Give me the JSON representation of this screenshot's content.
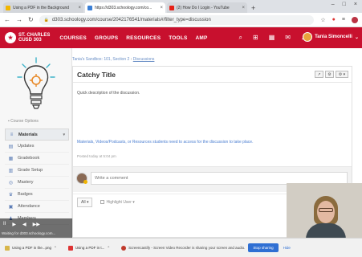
{
  "browser": {
    "tabs": [
      {
        "title": "Using a PDF in the Background",
        "favicon_color": "#f2b600"
      },
      {
        "title": "https://d303.schoology.com/co...",
        "favicon_color": "#3a7fd6"
      },
      {
        "title": "(2) How Do I Login - YouTube",
        "favicon_color": "#e62117"
      }
    ],
    "tab_close": "×",
    "new_tab": "+",
    "window_controls": [
      "–",
      "□",
      "×"
    ],
    "nav_back": "←",
    "nav_forward": "→",
    "nav_reload": "↻",
    "url": "d303.schoology.com/course/2042176541/materials#/filter_type=discussion",
    "lock_icon": "🔒"
  },
  "header": {
    "logo_line1": "ST. CHARLES",
    "logo_line2": "CUSD 303",
    "menu": [
      "COURSES",
      "GROUPS",
      "RESOURCES",
      "TOOLS",
      "AMP"
    ],
    "user_name": "Tania Simoncelli",
    "brand_color": "#c8102e"
  },
  "sidebar": {
    "course_options": "▪ Course Options",
    "items": [
      {
        "label": "Materials",
        "icon": "≡"
      },
      {
        "label": "Updates",
        "icon": "▤"
      },
      {
        "label": "Gradebook",
        "icon": "▦"
      },
      {
        "label": "Grade Setup",
        "icon": "▥"
      },
      {
        "label": "Mastery",
        "icon": "◎"
      },
      {
        "label": "Badges",
        "icon": "♛"
      },
      {
        "label": "Attendance",
        "icon": "▣"
      },
      {
        "label": "Members",
        "icon": "♟"
      }
    ],
    "chevron": "▾"
  },
  "content": {
    "breadcrumb": [
      "Tania's Sandbox: 101, Section 2",
      "Discussions"
    ],
    "breadcrumb_sep": "›",
    "title": "Catchy Title",
    "tools": [
      "↗",
      "⚙",
      "⚙ ▾"
    ],
    "description": "Quick description of the discussion.",
    "materials_text": "Materials, Videos/Podcasts, or Resources students need to access for the discussion to take place.",
    "posted": "Posted today at 5:04 pm",
    "comment_placeholder": "Write a comment",
    "filter_select": "All ▾",
    "highlight_label": "Highlight User ▾"
  },
  "video_controls": {
    "buttons": [
      "II",
      "▶",
      "◀",
      "▶▶"
    ],
    "status": "Waiting for d303.schoology.com..."
  },
  "bottombar": {
    "downloads": [
      {
        "label": "Using a PDF in the...png",
        "red": false
      },
      {
        "label": "Using a PDF in t...",
        "red": true
      }
    ],
    "share_message": "Screencastify - Screen Video Recorder is sharing your screen and audio.",
    "stop_label": "Stop sharing",
    "hide_label": "Hide"
  }
}
